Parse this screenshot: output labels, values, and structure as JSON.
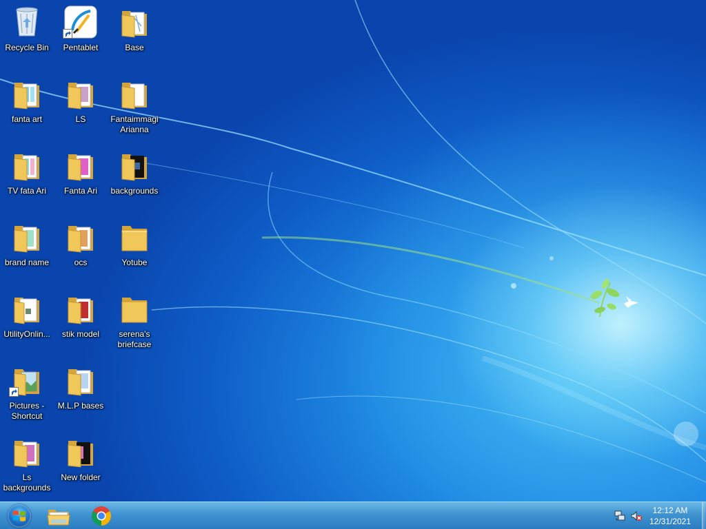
{
  "desktop": {
    "icons": [
      {
        "label": "Recycle Bin",
        "icon": "recycle-bin-icon"
      },
      {
        "label": "Pentablet",
        "icon": "pentablet-app-icon"
      },
      {
        "label": "Base",
        "icon": "folder-icon"
      },
      {
        "label": "fanta art",
        "icon": "folder-icon"
      },
      {
        "label": "LS",
        "icon": "folder-icon"
      },
      {
        "label": "Fantaimmagi\nArianna",
        "icon": "folder-icon"
      },
      {
        "label": "TV  fata Ari",
        "icon": "folder-icon"
      },
      {
        "label": "Fanta Ari",
        "icon": "folder-icon"
      },
      {
        "label": "backgrounds",
        "icon": "folder-icon"
      },
      {
        "label": "brand name",
        "icon": "folder-icon"
      },
      {
        "label": "ocs",
        "icon": "folder-icon"
      },
      {
        "label": "Yotube",
        "icon": "folder-icon"
      },
      {
        "label": "UtilityOnlin...",
        "icon": "document-icon"
      },
      {
        "label": "stik  model",
        "icon": "folder-icon"
      },
      {
        "label": "serena's\nbriefcase",
        "icon": "folder-icon"
      },
      {
        "label": "Pictures -\nShortcut",
        "icon": "shortcut-folder-icon"
      },
      {
        "label": "M.L.P bases",
        "icon": "folder-icon"
      },
      {
        "label": "Ls\nbackgrounds",
        "icon": "folder-icon"
      },
      {
        "label": "New folder",
        "icon": "folder-icon"
      }
    ]
  },
  "taskbar": {
    "start": {
      "icon": "windows-logo-icon"
    },
    "pinned": [
      {
        "icon": "file-explorer-icon"
      },
      {
        "icon": "chrome-icon"
      }
    ],
    "tray": {
      "network_icon": "network-icon",
      "volume_icon": "volume-muted-icon",
      "time": "12:12 AM",
      "date": "12/31/2021"
    }
  },
  "colors": {
    "folder": "#f0c85a",
    "folder_dark": "#d6a53a",
    "taskbar": "#3f93d0",
    "wallpaper_deep": "#0a47b0",
    "wallpaper_glow": "#bff0ff"
  }
}
